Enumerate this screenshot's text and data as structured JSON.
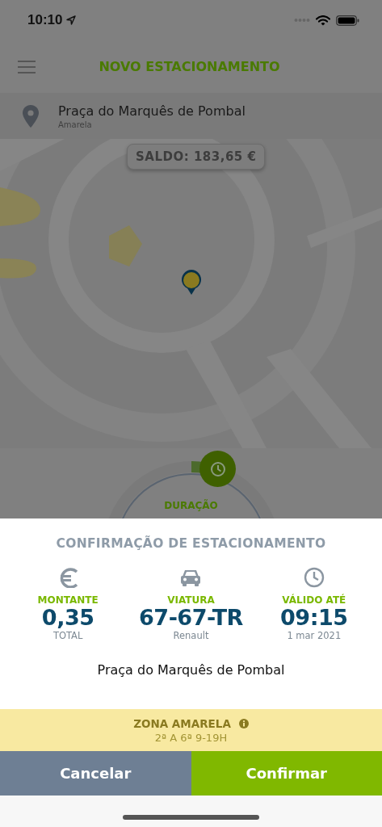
{
  "status_bar": {
    "time": "10:10"
  },
  "header": {
    "title": "NOVO ESTACIONAMENTO"
  },
  "location": {
    "name": "Praça do Marquês de Pombal",
    "zone": "Amarela"
  },
  "map": {
    "kind": "picture",
    "balance": "SALDO: 183,65 €"
  },
  "duration": {
    "label": "DURAÇÃO"
  },
  "confirmation": {
    "title": "CONFIRMAÇÃO DE ESTACIONAMENTO",
    "items": [
      {
        "kind": "amount",
        "label": "MONTANTE",
        "value": "0,35",
        "sub": "TOTAL"
      },
      {
        "kind": "vehicle",
        "label": "VIATURA",
        "value": "67-67-TR",
        "sub": "Renault"
      },
      {
        "kind": "time",
        "label": "VÁLIDO ATÉ",
        "value": "09:15",
        "sub": "1 mar 2021"
      }
    ],
    "place": "Praça do Marquês de Pombal"
  },
  "zone": {
    "name": "ZONA AMARELA",
    "hours": "2ª A 6ª 9-19H"
  },
  "buttons": [
    {
      "kind": "cancel",
      "label": "Cancelar"
    },
    {
      "kind": "confirm",
      "label": "Confirmar"
    }
  ]
}
